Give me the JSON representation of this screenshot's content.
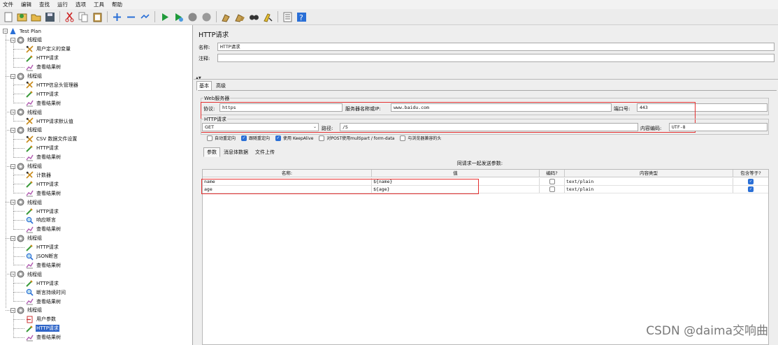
{
  "menu": [
    "文件",
    "编辑",
    "查找",
    "运行",
    "选项",
    "工具",
    "帮助"
  ],
  "toolbar_icons": [
    "new-icon",
    "templates-icon",
    "open-icon",
    "save-icon",
    "cut-icon",
    "copy-icon",
    "paste-icon",
    "expand-icon",
    "collapse-icon",
    "toggle-icon",
    "start-icon",
    "start-no-pause-icon",
    "stop-icon",
    "shutdown-icon",
    "clear-icon",
    "clear-all-icon",
    "search-icon",
    "reset-search-icon",
    "function-helper-icon",
    "help-icon"
  ],
  "tree": {
    "root": "Test Plan",
    "nodes": [
      {
        "label": "线程组",
        "level": 1
      },
      {
        "label": "用户定义的变量",
        "level": 2,
        "icon": "config"
      },
      {
        "label": "HTTP请求",
        "level": 2,
        "icon": "sampler"
      },
      {
        "label": "查看结果树",
        "level": 2,
        "icon": "listener"
      },
      {
        "label": "线程组",
        "level": 1
      },
      {
        "label": "HTTP信息头管理器",
        "level": 2,
        "icon": "config"
      },
      {
        "label": "HTTP请求",
        "level": 2,
        "icon": "sampler"
      },
      {
        "label": "查看结果树",
        "level": 2,
        "icon": "listener"
      },
      {
        "label": "线程组",
        "level": 1
      },
      {
        "label": "HTTP请求默认值",
        "level": 2,
        "icon": "config"
      },
      {
        "label": "线程组",
        "level": 1
      },
      {
        "label": "CSV 数据文件设置",
        "level": 2,
        "icon": "config"
      },
      {
        "label": "HTTP请求",
        "level": 2,
        "icon": "sampler"
      },
      {
        "label": "查看结果树",
        "level": 2,
        "icon": "listener"
      },
      {
        "label": "线程组",
        "level": 1
      },
      {
        "label": "计数器",
        "level": 2,
        "icon": "config"
      },
      {
        "label": "HTTP请求",
        "level": 2,
        "icon": "sampler"
      },
      {
        "label": "查看结果树",
        "level": 2,
        "icon": "listener"
      },
      {
        "label": "线程组",
        "level": 1
      },
      {
        "label": "HTTP请求",
        "level": 2,
        "icon": "sampler"
      },
      {
        "label": "响应断言",
        "level": 2,
        "icon": "assertion"
      },
      {
        "label": "查看结果树",
        "level": 2,
        "icon": "listener"
      },
      {
        "label": "线程组",
        "level": 1
      },
      {
        "label": "HTTP请求",
        "level": 2,
        "icon": "sampler"
      },
      {
        "label": "JSON断言",
        "level": 2,
        "icon": "assertion"
      },
      {
        "label": "查看结果树",
        "level": 2,
        "icon": "listener"
      },
      {
        "label": "线程组",
        "level": 1
      },
      {
        "label": "HTTP请求",
        "level": 2,
        "icon": "sampler"
      },
      {
        "label": "断言持续时间",
        "level": 2,
        "icon": "assertion"
      },
      {
        "label": "查看结果树",
        "level": 2,
        "icon": "listener"
      },
      {
        "label": "线程组",
        "level": 1
      },
      {
        "label": "用户参数",
        "level": 2,
        "icon": "preprocessor"
      },
      {
        "label": "HTTP请求",
        "level": 2,
        "icon": "sampler",
        "selected": true
      },
      {
        "label": "查看结果树",
        "level": 2,
        "icon": "listener"
      }
    ]
  },
  "panel": {
    "title": "HTTP请求",
    "name_label": "名称:",
    "name_value": "HTTP请求",
    "comment_label": "注释:",
    "comment_value": "",
    "tabs": [
      "基本",
      "高级"
    ],
    "web_server": {
      "title": "Web服务器",
      "protocol_label": "协议:",
      "protocol_value": "https",
      "server_label": "服务器名称或IP:",
      "server_value": "www.baidu.com",
      "port_label": "端口号:",
      "port_value": "443"
    },
    "http_request": {
      "title": "HTTP请求",
      "method": "GET",
      "path_label": "路径:",
      "path_value": "/S",
      "encoding_label": "内容编码:",
      "encoding_value": "UTF-8"
    },
    "checkboxes": [
      {
        "label": "自动重定向",
        "checked": false
      },
      {
        "label": "跟随重定向",
        "checked": true
      },
      {
        "label": "使用 KeepAlive",
        "checked": true
      },
      {
        "label": "对POST使用multipart / form-data",
        "checked": false
      },
      {
        "label": "与浏览器兼容的头",
        "checked": false
      }
    ],
    "subtabs": [
      "参数",
      "消息体数据",
      "文件上传"
    ],
    "params_caption": "同请求一起发送参数:",
    "columns": [
      "名称:",
      "值",
      "编码?",
      "内容类型",
      "包含等于?"
    ],
    "rows": [
      {
        "name": "name",
        "value": "${name}",
        "encode": false,
        "content_type": "text/plain",
        "include_equals": true
      },
      {
        "name": "age",
        "value": "${age}",
        "encode": false,
        "content_type": "text/plain",
        "include_equals": true
      }
    ]
  },
  "watermark": "CSDN @daima交响曲"
}
